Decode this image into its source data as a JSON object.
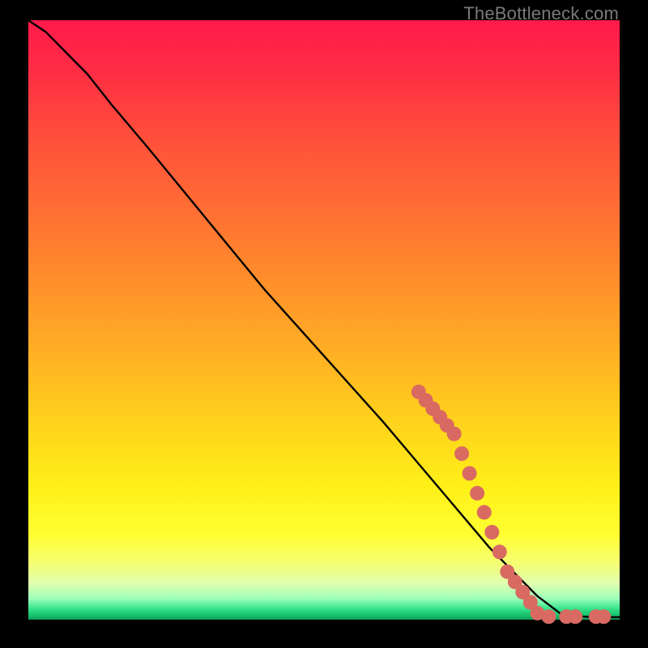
{
  "watermark": "TheBottleneck.com",
  "colors": {
    "background": "#000000",
    "curve": "#000000",
    "marker": "#d96a62",
    "gradient_top": "#ff1a4b",
    "gradient_bottom": "#0f9f59"
  },
  "chart_data": {
    "type": "line",
    "title": "",
    "xlabel": "",
    "ylabel": "",
    "xlim": [
      0,
      100
    ],
    "ylim": [
      0,
      100
    ],
    "grid": false,
    "legend": false,
    "series": [
      {
        "name": "curve",
        "x": [
          0,
          3,
          6,
          10,
          14,
          20,
          30,
          40,
          50,
          60,
          66,
          72,
          78,
          82,
          86,
          90,
          94,
          97,
          100
        ],
        "y": [
          100,
          98,
          95,
          91,
          86,
          79,
          67,
          55,
          44,
          33,
          26,
          19,
          12,
          8,
          4,
          1,
          0.5,
          0.4,
          0.4
        ]
      }
    ],
    "markers": [
      {
        "x": 66.0,
        "y": 38.0
      },
      {
        "x": 67.2,
        "y": 36.6
      },
      {
        "x": 68.4,
        "y": 35.2
      },
      {
        "x": 69.6,
        "y": 33.8
      },
      {
        "x": 70.8,
        "y": 32.4
      },
      {
        "x": 72.0,
        "y": 31.0
      },
      {
        "x": 73.3,
        "y": 27.7
      },
      {
        "x": 74.6,
        "y": 24.4
      },
      {
        "x": 75.9,
        "y": 21.1
      },
      {
        "x": 77.1,
        "y": 17.9
      },
      {
        "x": 78.4,
        "y": 14.6
      },
      {
        "x": 79.7,
        "y": 11.3
      },
      {
        "x": 81.0,
        "y": 8.0
      },
      {
        "x": 82.3,
        "y": 6.3
      },
      {
        "x": 83.6,
        "y": 4.6
      },
      {
        "x": 84.9,
        "y": 2.9
      },
      {
        "x": 86.1,
        "y": 1.1
      },
      {
        "x": 88.0,
        "y": 0.5
      },
      {
        "x": 91.0,
        "y": 0.5
      },
      {
        "x": 92.5,
        "y": 0.5
      },
      {
        "x": 96.0,
        "y": 0.5
      },
      {
        "x": 97.3,
        "y": 0.5
      }
    ],
    "marker_radius_px": 9
  }
}
